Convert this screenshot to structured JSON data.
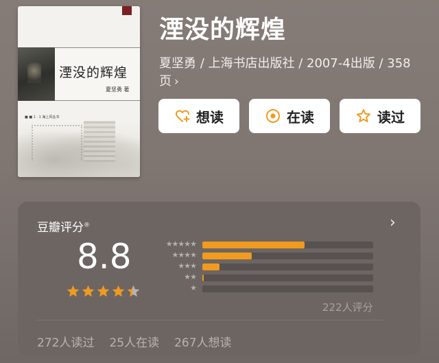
{
  "book": {
    "title": "湮没的辉煌",
    "meta": "夏坚勇 / 上海书店出版社 / 2007-4出版 / 358页",
    "chevron": "›",
    "cover": {
      "title": "湮没的辉煌",
      "author": "夏坚勇 著",
      "series": "■ ■ 1 · 1 海上风丛书"
    }
  },
  "actions": {
    "want": {
      "label": "想读",
      "icon": "heart-plus-icon"
    },
    "reading": {
      "label": "在读",
      "icon": "target-circle-icon"
    },
    "read": {
      "label": "读过",
      "icon": "star-outline-icon"
    }
  },
  "rating": {
    "title": "豆瓣评分",
    "trademark": "®",
    "score": "8.8",
    "stars": 4.4,
    "distribution": [
      {
        "stars_label": "★★★★★",
        "fraction": 0.6
      },
      {
        "stars_label": "★★★★",
        "fraction": 0.29
      },
      {
        "stars_label": "★★★",
        "fraction": 0.1
      },
      {
        "stars_label": "★★",
        "fraction": 0.01
      },
      {
        "stars_label": "★",
        "fraction": 0.0
      }
    ],
    "count_label": "222人评分",
    "chevron": "›"
  },
  "stats": {
    "read": "272人读过",
    "reading": "25人在读",
    "want": "267人想读"
  },
  "colors": {
    "accent_orange": "#f09a1f",
    "track": "#57514f",
    "button_bg": "#ffffff"
  }
}
